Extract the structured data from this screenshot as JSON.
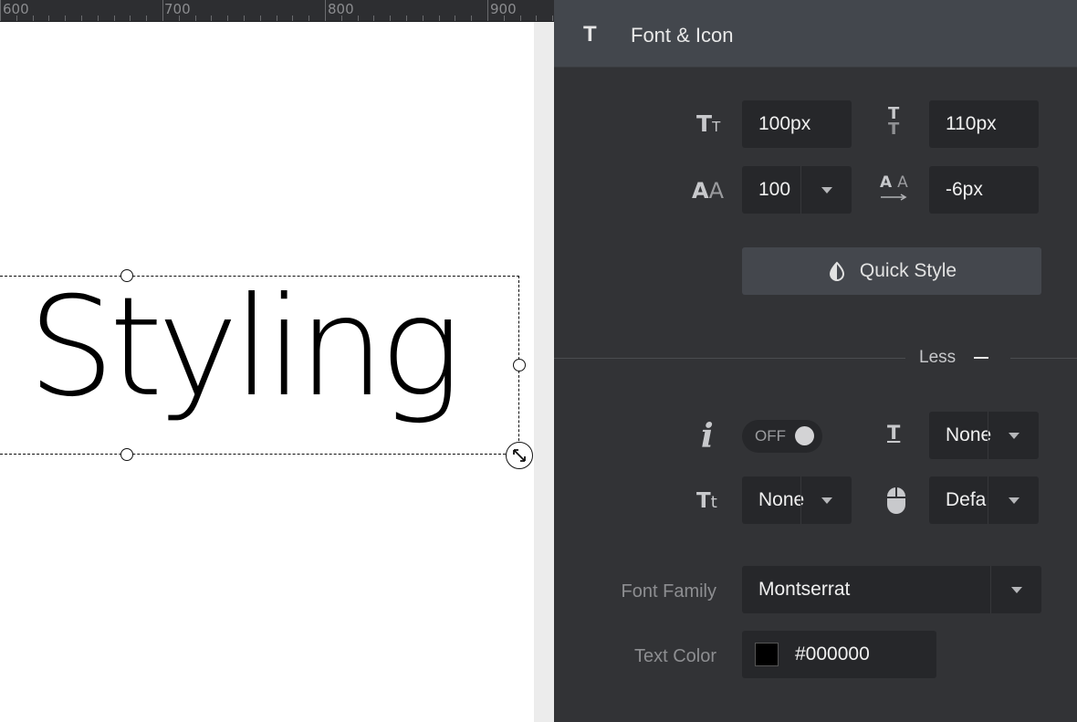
{
  "ruler": {
    "marks": [
      "600",
      "700",
      "800",
      "900"
    ]
  },
  "canvas": {
    "layer_text": "t Styling"
  },
  "panel": {
    "title": "Font & Icon",
    "font_size": "100px",
    "line_height": "110px",
    "font_weight": "100",
    "letter_spacing": "-6px",
    "quick_style_label": "Quick Style",
    "less_label": "Less",
    "italic_toggle": "OFF",
    "text_decoration": "None",
    "text_transform": "None",
    "cursor": "Defa",
    "font_family_label": "Font Family",
    "font_family": "Montserrat",
    "text_color_label": "Text Color",
    "text_color": "#000000"
  },
  "colors": {
    "panel_bg": "#323336",
    "panel_header_bg": "#43474d",
    "field_bg": "#26272a",
    "text_color_value": "#000000"
  },
  "icons": [
    "text-icon",
    "font-size-icon",
    "line-height-icon",
    "font-weight-icon",
    "letter-spacing-icon",
    "contrast-icon",
    "italic-icon",
    "underline-text-icon",
    "text-transform-icon",
    "mouse-icon",
    "caret-down-icon",
    "resize-icon"
  ]
}
